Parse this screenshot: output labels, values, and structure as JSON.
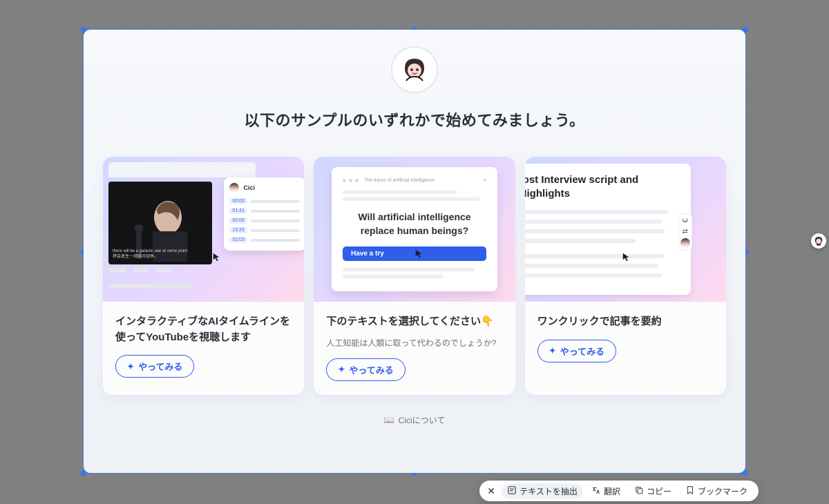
{
  "heading": "以下のサンプルのいずれかで始めてみましょう。",
  "try_label": "やってみる",
  "about_label": "Ciciについて",
  "cards": [
    {
      "title": "インタラクティブなAIタイムラインを使ってYouTubeを視聴します",
      "panel_name": "Cici",
      "caption_line1": "there will be a galactic war at some point.",
      "caption_line2": "将会发生一场银河战争。",
      "ts": [
        "00:00",
        "01:41",
        "02:00",
        "13:25",
        "02:03"
      ]
    },
    {
      "title": "下のテキストを選択してください👇",
      "sub": "人工知能は人類に取って代わるのでしょうか?",
      "tab_label": "The future of artificial intelligence",
      "question": "Will artificial intelligence replace human beings?",
      "cta": "Have a try"
    },
    {
      "title": "ワンクリックで記事を要約",
      "doc_title": "-ost Interview script and Highlights"
    }
  ],
  "toolbar": {
    "extract": "テキストを抽出",
    "translate": "翻訳",
    "copy": "コピー",
    "bookmark": "ブックマーク"
  }
}
